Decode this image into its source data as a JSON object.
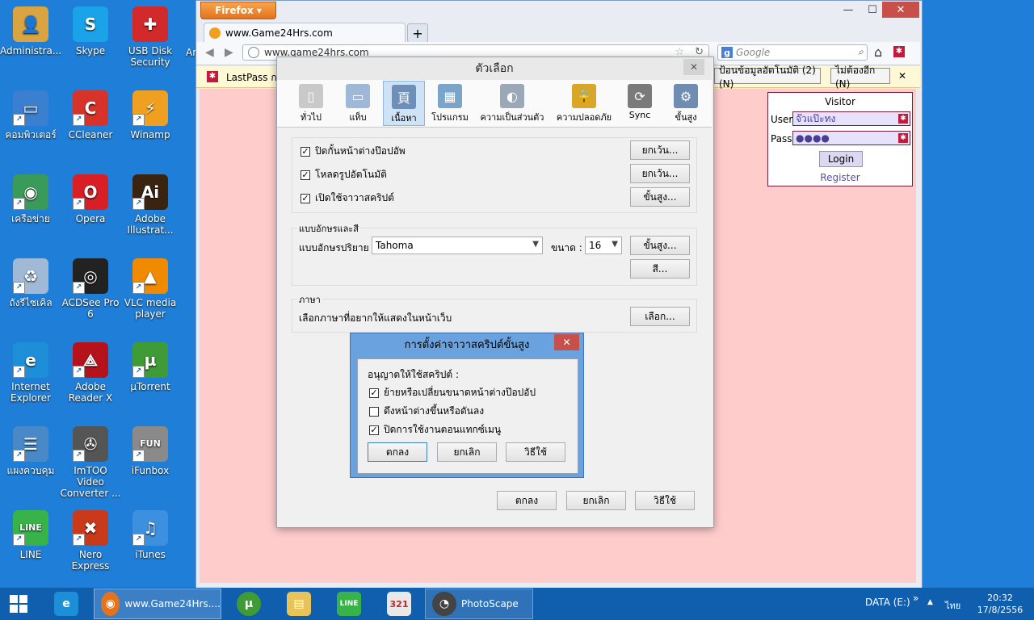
{
  "desktop": {
    "icons": [
      {
        "label": "Administra...",
        "icon": "user-folder-icon",
        "color": "#d9a441",
        "glyph": "👤"
      },
      {
        "label": "Skype",
        "icon": "skype-icon",
        "color": "#1aa3e8",
        "glyph": "S"
      },
      {
        "label": "USB Disk Security",
        "icon": "usb-security-icon",
        "color": "#d22a2a",
        "glyph": "✚"
      },
      {
        "label": "คอมพิวเตอร์",
        "icon": "computer-icon",
        "color": "#3b7fd1",
        "glyph": "▭"
      },
      {
        "label": "CCleaner",
        "icon": "ccleaner-icon",
        "color": "#d8332a",
        "glyph": "C"
      },
      {
        "label": "Winamp",
        "icon": "winamp-icon",
        "color": "#f0a020",
        "glyph": "⚡"
      },
      {
        "label": "เครือข่าย",
        "icon": "network-icon",
        "color": "#3a9a5a",
        "glyph": "◉"
      },
      {
        "label": "Opera",
        "icon": "opera-icon",
        "color": "#d81f26",
        "glyph": "O"
      },
      {
        "label": "Adobe Illustrat...",
        "icon": "illustrator-icon",
        "color": "#3a2410",
        "glyph": "Ai"
      },
      {
        "label": "ถังรีไซเคิล",
        "icon": "recycle-bin-icon",
        "color": "#9fb9d6",
        "glyph": "♻"
      },
      {
        "label": "ACDSee Pro 6",
        "icon": "acdsee-icon",
        "color": "#222",
        "glyph": "◎"
      },
      {
        "label": "VLC media player",
        "icon": "vlc-icon",
        "color": "#f08a00",
        "glyph": "▲"
      },
      {
        "label": "Internet Explorer",
        "icon": "ie-icon",
        "color": "#1c8fd8",
        "glyph": "e"
      },
      {
        "label": "Adobe Reader X",
        "icon": "adobe-reader-icon",
        "color": "#b5121b",
        "glyph": "⟁"
      },
      {
        "label": "µTorrent",
        "icon": "utorrent-icon",
        "color": "#3f9b35",
        "glyph": "µ"
      },
      {
        "label": "แผงควบคุม",
        "icon": "control-panel-icon",
        "color": "#4a89c8",
        "glyph": "☰"
      },
      {
        "label": "ImTOO Video Converter ...",
        "icon": "video-converter-icon",
        "color": "#555",
        "glyph": "✇"
      },
      {
        "label": "iFunbox",
        "icon": "ifunbox-icon",
        "color": "#8a8a8a",
        "glyph": "FUN"
      },
      {
        "label": "LINE",
        "icon": "line-icon",
        "color": "#37b34a",
        "glyph": "LINE"
      },
      {
        "label": "Nero Express",
        "icon": "nero-icon",
        "color": "#c83a1a",
        "glyph": "✖"
      },
      {
        "label": "iTunes",
        "icon": "itunes-icon",
        "color": "#3d8fe0",
        "glyph": "♫"
      }
    ],
    "partial_label": "Ar"
  },
  "firefox": {
    "menu_label": "Firefox ▾",
    "tab_title": "www.Game24Hrs.com",
    "new_tab": "+",
    "url": "www.game24hrs.com",
    "search_engine_icon": "g",
    "search_placeholder": "Google",
    "minimize": "—",
    "maximize": "☐",
    "close": "✕",
    "notification": {
      "text": "LastPass กร",
      "autofill_button": "ป้อนข้อมูลอัตโนมัติ (2) (N)",
      "never_button": "ไม่ต้องอีก (N)",
      "close": "✕"
    }
  },
  "login_widget": {
    "title": "Visitor",
    "user_label": "User",
    "user_value": "จ๊วแป๊ะทง",
    "pass_label": "Pass",
    "pass_value": "●●●●",
    "login_button": "Login",
    "register_link": "Register"
  },
  "options_dialog": {
    "title": "ตัวเลือก",
    "close": "✕",
    "tabs": [
      {
        "label": "ทั่วไป",
        "icon": "general-switch-icon",
        "color": "#c9c9c9",
        "glyph": "▯",
        "selected": false
      },
      {
        "label": "แท็บ",
        "icon": "tabs-icon",
        "color": "#9fb8d8",
        "glyph": "▭",
        "selected": false
      },
      {
        "label": "เนื้อหา",
        "icon": "content-icon",
        "color": "#6d8fb8",
        "glyph": "頁",
        "selected": true
      },
      {
        "label": "โปรแกรม",
        "icon": "applications-icon",
        "color": "#7aa4c8",
        "glyph": "▦",
        "selected": false
      },
      {
        "label": "ความเป็นส่วนตัว",
        "icon": "privacy-mask-icon",
        "color": "#9aa8b8",
        "glyph": "◐",
        "selected": false
      },
      {
        "label": "ความปลอดภัย",
        "icon": "security-lock-icon",
        "color": "#d9a62a",
        "glyph": "🔒",
        "selected": false
      },
      {
        "label": "Sync",
        "icon": "sync-icon",
        "color": "#7a7a7a",
        "glyph": "⟳",
        "selected": false
      },
      {
        "label": "ขั้นสูง",
        "icon": "advanced-gear-icon",
        "color": "#6f8db0",
        "glyph": "⚙",
        "selected": false
      }
    ],
    "checks": [
      {
        "label": "ปิดกั้นหน้าต่างป๊อปอัพ",
        "checked": true,
        "button": "ยกเว้น..."
      },
      {
        "label": "โหลดรูปอัตโนมัติ",
        "checked": true,
        "button": "ยกเว้น..."
      },
      {
        "label": "เปิดใช้จาวาสคริปต์",
        "checked": true,
        "button": "ขั้นสูง..."
      }
    ],
    "fonts": {
      "legend": "แบบอักษรและสี",
      "default_font_label": "แบบอักษรปริยาย :",
      "default_font_value": "Tahoma",
      "size_label": "ขนาด :",
      "size_value": "16",
      "advanced_button": "ขั้นสูง...",
      "colors_button": "สี..."
    },
    "languages": {
      "legend": "ภาษา",
      "text": "เลือกภาษาที่อยากให้แสดงในหน้าเว็บ",
      "choose_button": "เลือก..."
    },
    "ok": "ตกลง",
    "cancel": "ยกเลิก",
    "help": "วิธีใช้"
  },
  "advanced_js_dialog": {
    "title": "การตั้งค่าจาวาสคริปต์ขั้นสูง",
    "close": "✕",
    "heading": "อนุญาตให้ใช้สคริปต์ :",
    "options": [
      {
        "label": "ย้ายหรือเปลี่ยนขนาดหน้าต่างป๊อปอัป",
        "checked": true
      },
      {
        "label": "ดึงหน้าต่างขึ้นหรือดันลง",
        "checked": false
      },
      {
        "label": "ปิดการใช้งานตอนแทกซ์เมนู",
        "checked": true
      }
    ],
    "ok": "ตกลง",
    "cancel": "ยกเลิก",
    "help": "วิธีใช้"
  },
  "taskbar": {
    "start_icon": "windows-start-icon",
    "firefox_task": "www.Game24Hrs....",
    "photoscape_task": "PhotoScape",
    "drive_label": "DATA (E:)",
    "overflow": "»",
    "tray_arrow": "▲",
    "language": "ไทย",
    "time": "20:32",
    "date": "17/8/2556"
  }
}
